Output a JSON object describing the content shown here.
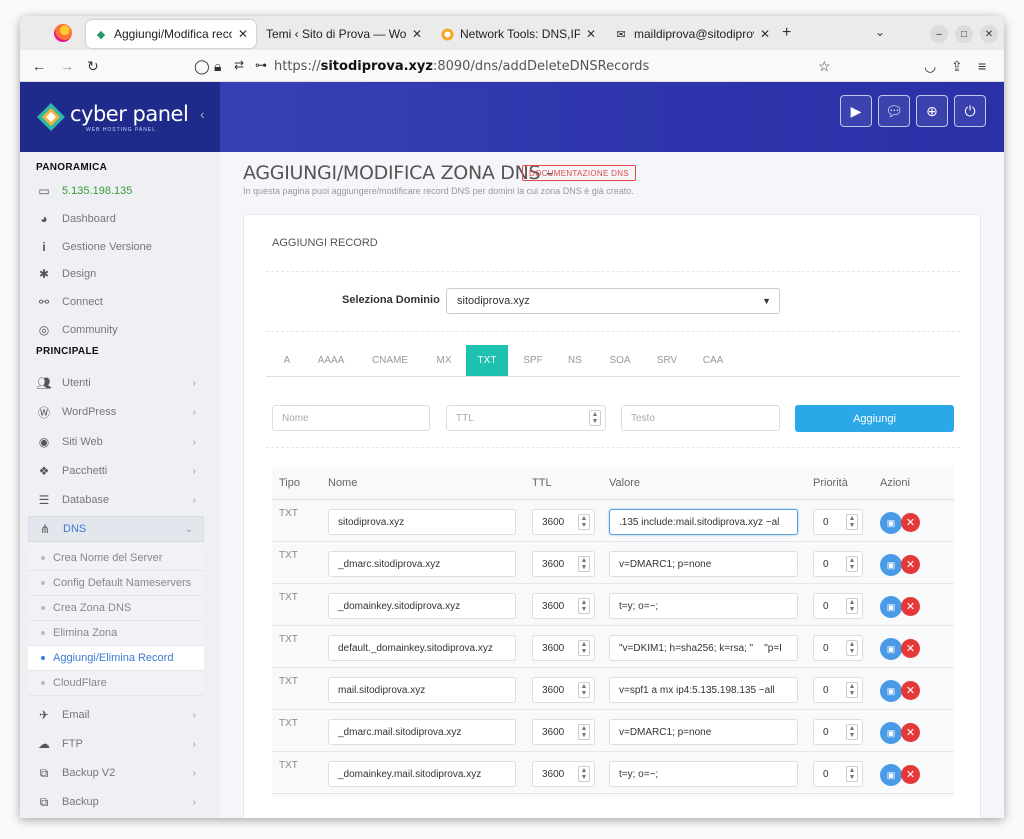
{
  "browser": {
    "tabs": [
      {
        "title": "Aggiungi/Modifica record",
        "icon": "cyberpanel-favicon-icon"
      },
      {
        "title": "Temi ‹ Sito di Prova — WordP",
        "icon": ""
      },
      {
        "title": "Network Tools: DNS,IP,Em",
        "icon": "network-tools-favicon-icon"
      },
      {
        "title": "maildiprova@sitodiprova",
        "icon": "mail-icon"
      }
    ],
    "url_scheme": "https://",
    "url_host": "sitodiprova.xyz",
    "url_path": ":8090/dns/addDeleteDNSRecords"
  },
  "brand": {
    "name": "cyber panel",
    "sub": "WEB HOSTING PANEL"
  },
  "sidebar": {
    "panoramica": "PANORAMICA",
    "ip": "5.135.198.135",
    "items_top": [
      {
        "label": "Dashboard",
        "icon": "dashboard-icon"
      },
      {
        "label": "Gestione Versione",
        "icon": "info-icon"
      },
      {
        "label": "Design",
        "icon": "gear-icon"
      },
      {
        "label": "Connect",
        "icon": "connect-icon"
      },
      {
        "label": "Community",
        "icon": "community-icon"
      }
    ],
    "principale": "PRINCIPALE",
    "items_main": [
      {
        "label": "Utenti",
        "icon": "users-icon"
      },
      {
        "label": "WordPress",
        "icon": "wordpress-icon"
      },
      {
        "label": "Siti Web",
        "icon": "globe-icon"
      },
      {
        "label": "Pacchetti",
        "icon": "packages-icon"
      },
      {
        "label": "Database",
        "icon": "database-icon"
      }
    ],
    "dns": "DNS",
    "dns_sub": [
      "Crea Nome del Server",
      "Config Default Nameservers",
      "Crea Zona DNS",
      "Elimina Zona",
      "Aggiungi/Elimina Record",
      "CloudFlare"
    ],
    "items_bottom": [
      {
        "label": "Email",
        "icon": "email-icon"
      },
      {
        "label": "FTP",
        "icon": "cloud-upload-icon"
      },
      {
        "label": "Backup V2",
        "icon": "backup-icon"
      },
      {
        "label": "Backup",
        "icon": "backup-icon"
      }
    ]
  },
  "page": {
    "title": "AGGIUNGI/MODIFICA ZONA DNS -",
    "doc_badge": "DOCUMENTAZIONE DNS",
    "subtitle": "In questa pagina puoi aggiungere/modificare record DNS per domini la cui zona DNS è già creato.",
    "card_title": "AGGIUNGI RECORD",
    "select_label": "Seleziona Dominio",
    "select_value": "sitodiprova.xyz",
    "record_tabs": [
      "A",
      "AAAA",
      "CNAME",
      "MX",
      "TXT",
      "SPF",
      "NS",
      "SOA",
      "SRV",
      "CAA"
    ],
    "active_tab": "TXT",
    "placeholder_name": "Nome",
    "placeholder_ttl": "TTL",
    "placeholder_text": "Testo",
    "add_button": "Aggiungi"
  },
  "table": {
    "headers": {
      "tipo": "Tipo",
      "nome": "Nome",
      "ttl": "TTL",
      "valore": "Valore",
      "priorita": "Priorità",
      "azioni": "Azioni"
    },
    "rows": [
      {
        "tipo": "TXT",
        "nome": "sitodiprova.xyz",
        "ttl": "3600",
        "valore": ".135 include:mail.sitodiprova.xyz ~al",
        "priorita": "0"
      },
      {
        "tipo": "TXT",
        "nome": "_dmarc.sitodiprova.xyz",
        "ttl": "3600",
        "valore": "v=DMARC1; p=none",
        "priorita": "0"
      },
      {
        "tipo": "TXT",
        "nome": "_domainkey.sitodiprova.xyz",
        "ttl": "3600",
        "valore": "t=y; o=~;",
        "priorita": "0"
      },
      {
        "tipo": "TXT",
        "nome": "default._domainkey.sitodiprova.xyz",
        "ttl": "3600",
        "valore": "\"v=DKIM1; h=sha256; k=rsa; \"    \"p=I",
        "priorita": "0"
      },
      {
        "tipo": "TXT",
        "nome": "mail.sitodiprova.xyz",
        "ttl": "3600",
        "valore": "v=spf1 a mx ip4:5.135.198.135 ~all",
        "priorita": "0"
      },
      {
        "tipo": "TXT",
        "nome": "_dmarc.mail.sitodiprova.xyz",
        "ttl": "3600",
        "valore": "v=DMARC1; p=none",
        "priorita": "0"
      },
      {
        "tipo": "TXT",
        "nome": "_domainkey.mail.sitodiprova.xyz",
        "ttl": "3600",
        "valore": "t=y; o=~;",
        "priorita": "0"
      }
    ]
  }
}
